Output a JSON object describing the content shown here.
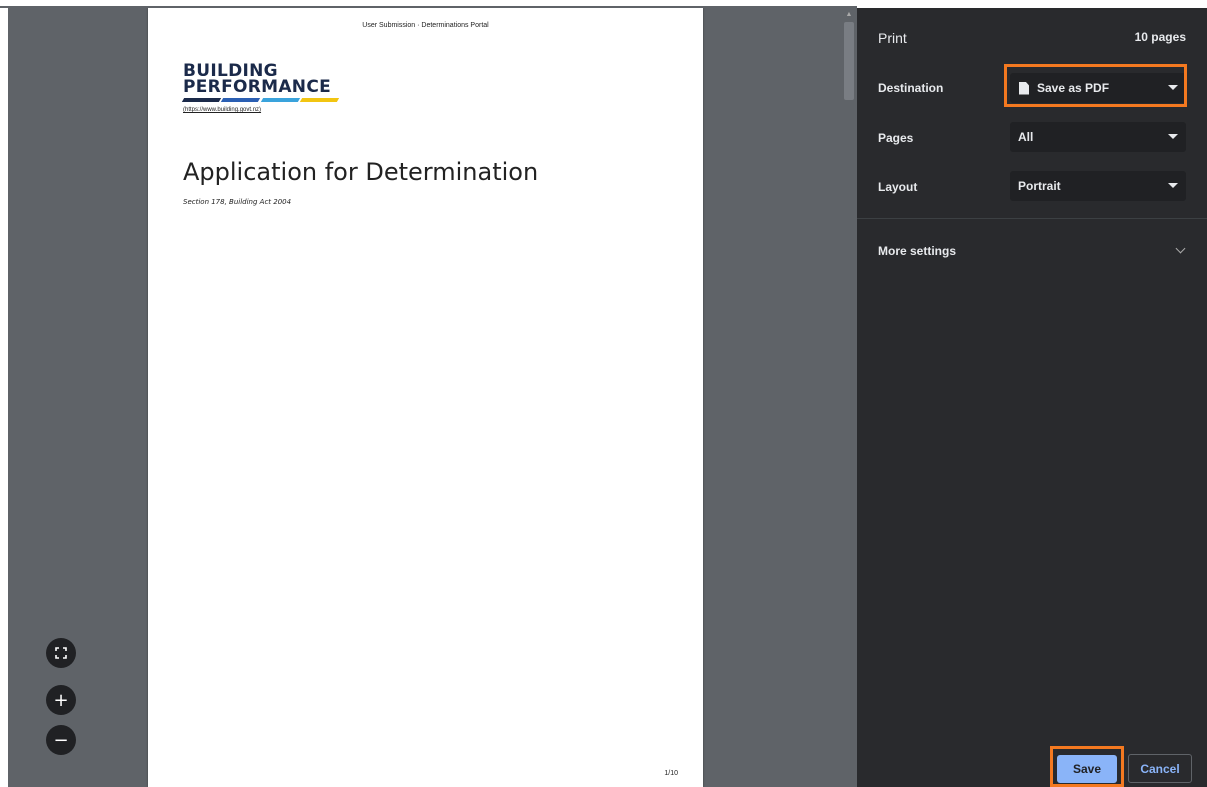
{
  "document": {
    "header_text": "User Submission · Determinations Portal",
    "logo_line1": "BUILDING",
    "logo_line2": "PERFORMANCE",
    "logo_url": "(https://www.building.govt.nz)",
    "logo_stripe_colors": [
      "#1b2a4a",
      "#2b5fb3",
      "#3aa3dc",
      "#f2c511"
    ],
    "title": "Application for Determination",
    "subtitle": "Section 178, Building Act 2004",
    "page_number": "1/10"
  },
  "zoom_controls": {
    "fit_icon": "fit-to-page-icon",
    "zoom_in_icon": "zoom-in-icon",
    "zoom_out_icon": "zoom-out-icon"
  },
  "print_panel": {
    "title": "Print",
    "page_count": "10 pages",
    "destination_label": "Destination",
    "destination_value": "Save as PDF",
    "pages_label": "Pages",
    "pages_value": "All",
    "layout_label": "Layout",
    "layout_value": "Portrait",
    "more_settings_label": "More settings",
    "save_label": "Save",
    "cancel_label": "Cancel"
  },
  "colors": {
    "highlight": "#f47920",
    "panel_bg": "#292a2d",
    "preview_bg": "#5f6368",
    "accent": "#8ab4f8"
  }
}
